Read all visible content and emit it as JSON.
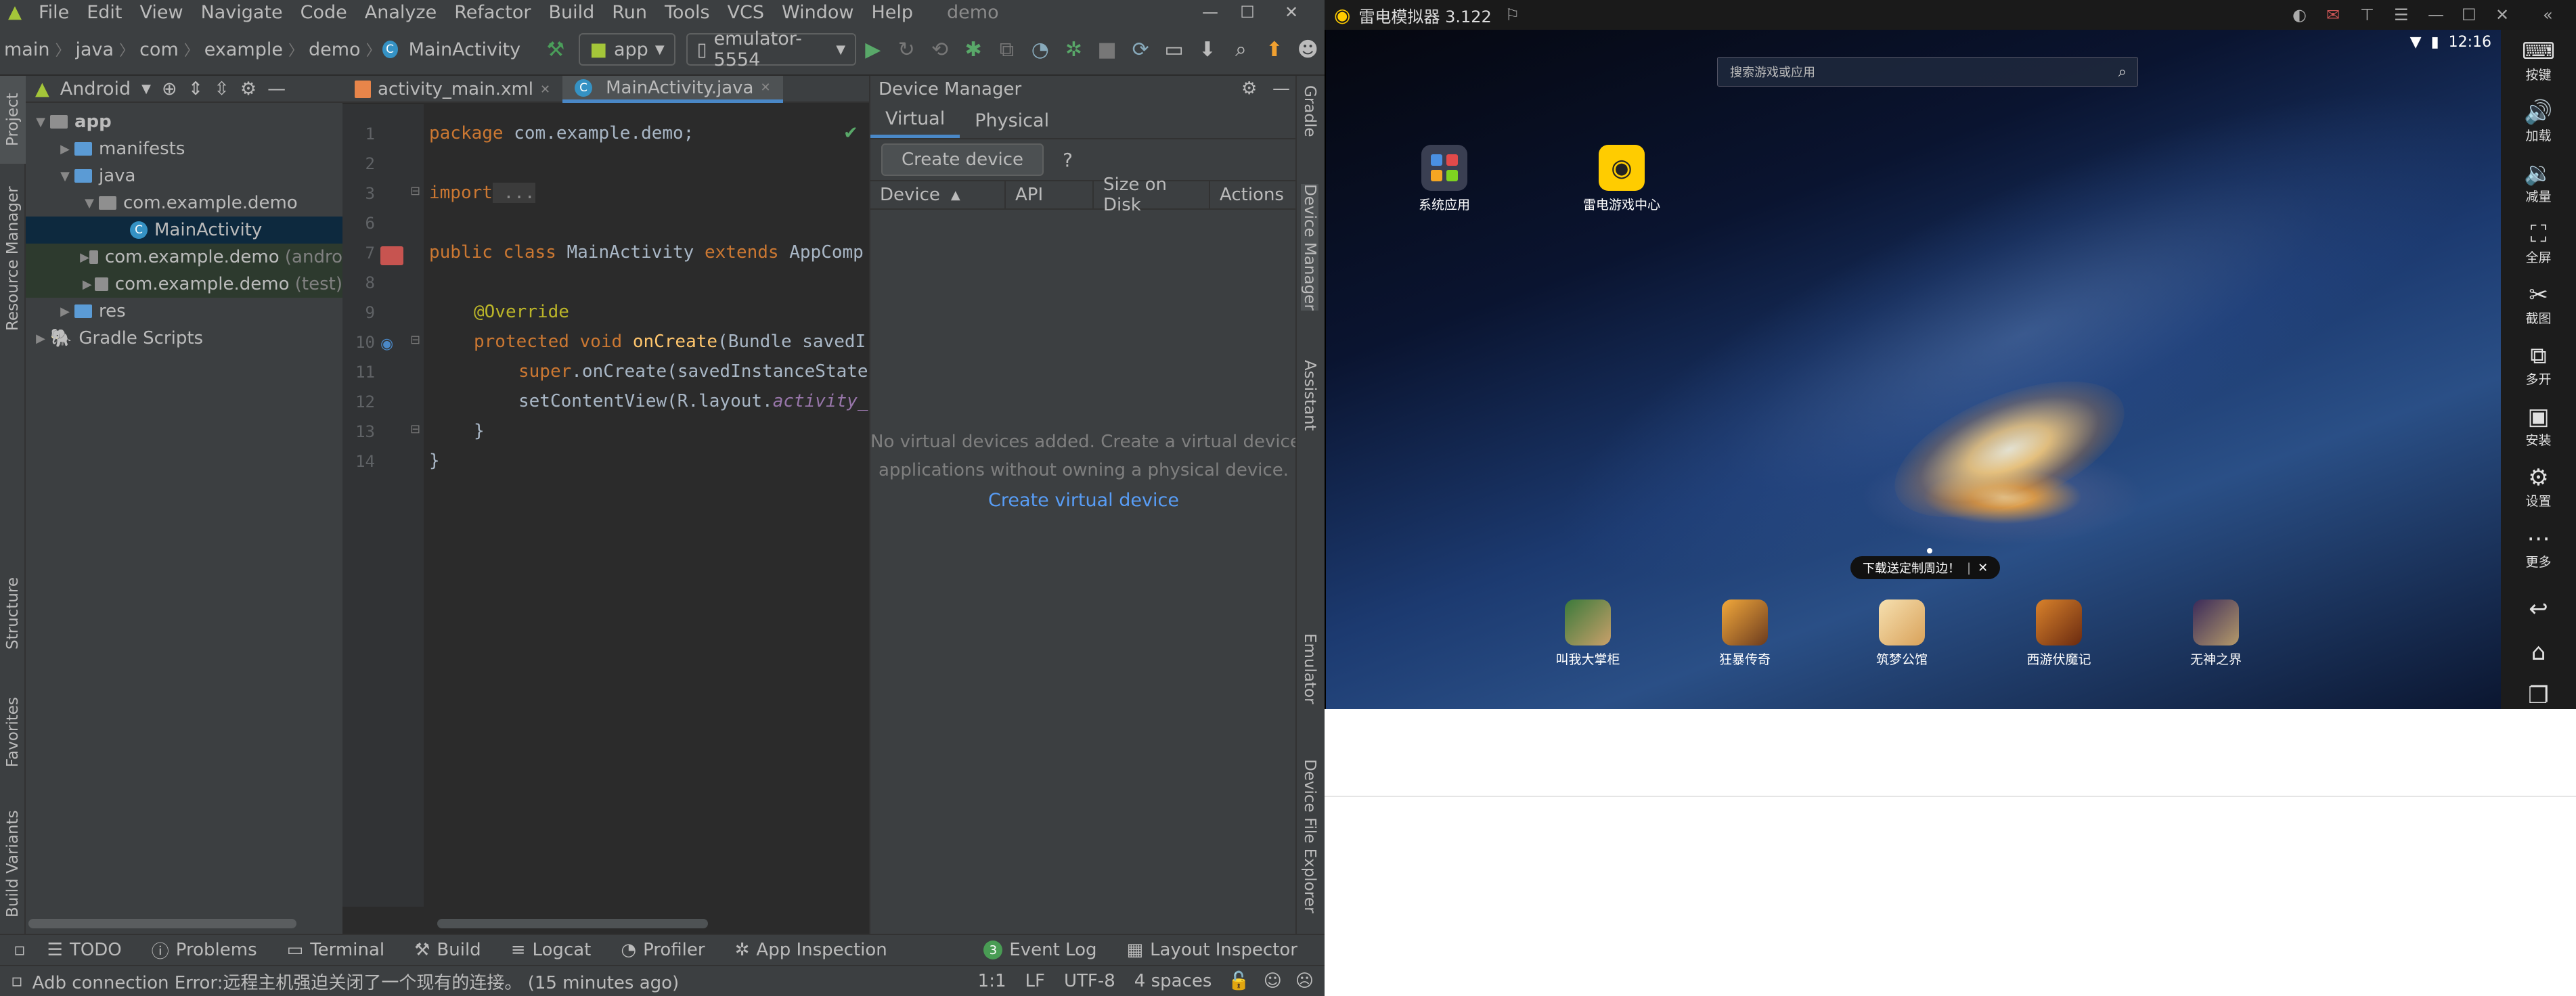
{
  "studio": {
    "menu": [
      "File",
      "Edit",
      "View",
      "Navigate",
      "Code",
      "Analyze",
      "Refactor",
      "Build",
      "Run",
      "Tools",
      "VCS",
      "Window",
      "Help"
    ],
    "project_name": "demo",
    "breadcrumb": [
      "main",
      "java",
      "com",
      "example",
      "demo",
      "MainActivity"
    ],
    "run_config": "app",
    "device_selector": "emulator-5554",
    "left_tabs": [
      "Project",
      "Resource Manager",
      "Structure",
      "Favorites",
      "Build Variants"
    ],
    "right_tabs": [
      "Gradle",
      "Device Manager",
      "Assistant",
      "Emulator",
      "Device File Explorer"
    ],
    "project_view": "Android",
    "tree": [
      {
        "label": "app",
        "muted": ""
      },
      {
        "label": "manifests",
        "muted": ""
      },
      {
        "label": "java",
        "muted": ""
      },
      {
        "label": "com.example.demo",
        "muted": ""
      },
      {
        "label": "MainActivity",
        "muted": ""
      },
      {
        "label": "com.example.demo",
        "muted": "(andro"
      },
      {
        "label": "com.example.demo",
        "muted": "(test)"
      },
      {
        "label": "res",
        "muted": ""
      },
      {
        "label": "Gradle Scripts",
        "muted": ""
      }
    ],
    "editor_tabs": [
      "activity_main.xml",
      "MainActivity.java"
    ],
    "line_numbers": [
      "1",
      "2",
      "3",
      "6",
      "7",
      "8",
      "9",
      "10",
      "11",
      "12",
      "13",
      "14"
    ],
    "code": {
      "l1_kw": "package",
      "l1_rest": " com.example.demo;",
      "l3_kw": "import",
      "l3_rest": " ...",
      "l7_kw": "public class",
      "l7_name": " MainActivity ",
      "l7_ext": "extends",
      "l7_rest": " AppComp",
      "l9": "@Override",
      "l10_kw": "protected void ",
      "l10_fn": "onCreate",
      "l10_rest": "(Bundle savedI",
      "l11_kw": "super",
      ".l11_rest": "",
      "l11_rest": ".onCreate(savedInstanceState",
      "l12_a": "setContentView(R.layout.",
      "l12_b": "activity_",
      "l13": "}",
      "l14": "}"
    },
    "device_manager": {
      "title": "Device Manager",
      "tabs": [
        "Virtual",
        "Physical"
      ],
      "create_button": "Create device",
      "help": "?",
      "columns": [
        "Device",
        "API",
        "Size on Disk",
        "Actions"
      ],
      "empty_line1": "No virtual devices added. Create a virtual device to test",
      "empty_line2": "applications without owning a physical device.",
      "link": "Create virtual device"
    },
    "bottom_tools": [
      "TODO",
      "Problems",
      "Terminal",
      "Build",
      "Logcat",
      "Profiler",
      "App Inspection"
    ],
    "event_log_count": "3",
    "event_log": "Event Log",
    "layout_inspector": "Layout Inspector",
    "status_message": "Adb connection Error:远程主机强迫关闭了一个现有的连接。 (15 minutes ago)",
    "status_position": "1:1",
    "status_lf": "LF",
    "status_encoding": "UTF-8",
    "status_indent": "4 spaces"
  },
  "emulator": {
    "title": "雷电模拟器 3.122",
    "time": "12:16",
    "search_placeholder": "搜索游戏或应用",
    "top_apps": [
      "系统应用",
      "雷电游戏中心"
    ],
    "tip": "下载送定制周边！",
    "tip_close": "✕",
    "dock_apps": [
      "叫我大掌柜",
      "狂暴传奇",
      "筑梦公馆",
      "西游伏魔记",
      "无神之界"
    ],
    "side_buttons": [
      "按键",
      "加载",
      "减量",
      "全屏",
      "截图",
      "多开",
      "安装",
      "设置",
      "更多"
    ],
    "colors": {
      "accent": "#ffcc00",
      "sidebar": "#1c1c1c"
    }
  },
  "colors": {
    "ide_bg": "#2b2b2b",
    "ide_panel": "#3c3f41",
    "link": "#589df6",
    "selection": "#0d293e"
  }
}
